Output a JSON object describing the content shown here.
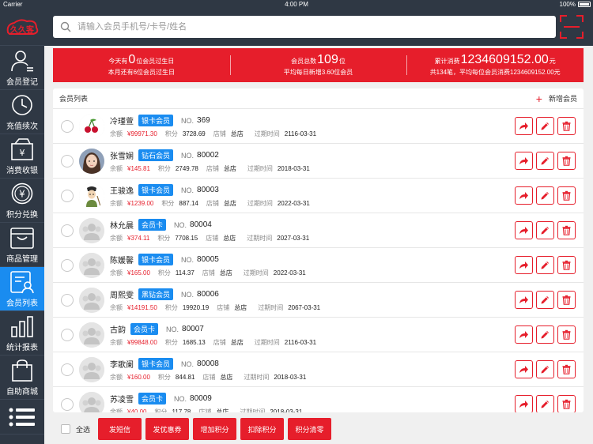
{
  "status": {
    "carrier": "Carrier",
    "time": "4:00 PM",
    "battery": "100%"
  },
  "app": {
    "logo": "久久客"
  },
  "sidebar": {
    "items": [
      {
        "label": "会员登记",
        "icon": "member-register-icon"
      },
      {
        "label": "充值续次",
        "icon": "clock-icon"
      },
      {
        "label": "消费收银",
        "icon": "cashier-icon"
      },
      {
        "label": "积分兑换",
        "icon": "points-exchange-icon"
      },
      {
        "label": "商品管理",
        "icon": "product-box-icon"
      },
      {
        "label": "会员列表",
        "icon": "member-list-icon",
        "active": true
      },
      {
        "label": "统计报表",
        "icon": "bar-chart-icon"
      },
      {
        "label": "自助商城",
        "icon": "shopping-bag-icon"
      }
    ],
    "menu_icon": "menu-icon"
  },
  "search": {
    "placeholder": "请输入会员手机号/卡号/姓名"
  },
  "stats": {
    "birthday": {
      "prefix": "今天有",
      "count": "0",
      "suffix": "位会员过生日",
      "sub": "本月还有6位会员过生日"
    },
    "members": {
      "prefix": "会员总数",
      "count": "109",
      "suffix": "位",
      "sub": "平均每日新增3.60位会员"
    },
    "spend": {
      "prefix": "累计消费",
      "count": "1234609152.00",
      "suffix": "元",
      "sub": "共134笔，平均每位会员消费1234609152.00元"
    }
  },
  "list": {
    "title": "会员列表",
    "add_label": "新增会员",
    "labels": {
      "no": "NO.",
      "balance": "余额",
      "points": "积分",
      "store": "店铺",
      "expiry": "过期时间"
    },
    "rows": [
      {
        "name": "冷瑾萱",
        "level": "银卡会员",
        "no": "369",
        "balance": "¥99971.30",
        "points": "3728.69",
        "store": "总店",
        "expiry": "2116-03-31",
        "avatar": "cherries"
      },
      {
        "name": "张雪娴",
        "level": "钻石会员",
        "no": "80002",
        "balance": "¥145.81",
        "points": "2749.78",
        "store": "总店",
        "expiry": "2018-03-31",
        "avatar": "girl"
      },
      {
        "name": "王骏逸",
        "level": "银卡会员",
        "no": "80003",
        "balance": "¥1239.00",
        "points": "887.14",
        "store": "总店",
        "expiry": "2022-03-31",
        "avatar": "cartoon"
      },
      {
        "name": "林允晨",
        "level": "会员卡",
        "no": "80004",
        "balance": "¥374.11",
        "points": "7708.15",
        "store": "总店",
        "expiry": "2027-03-31",
        "avatar": "default"
      },
      {
        "name": "陈媛馨",
        "level": "银卡会员",
        "no": "80005",
        "balance": "¥165.00",
        "points": "114.37",
        "store": "总店",
        "expiry": "2022-03-31",
        "avatar": "default"
      },
      {
        "name": "周熙雯",
        "level": "黑钻会员",
        "no": "80006",
        "balance": "¥14191.50",
        "points": "19920.19",
        "store": "总店",
        "expiry": "2067-03-31",
        "avatar": "default"
      },
      {
        "name": "古韵",
        "level": "会员卡",
        "no": "80007",
        "balance": "¥99848.00",
        "points": "1685.13",
        "store": "总店",
        "expiry": "2116-03-31",
        "avatar": "default"
      },
      {
        "name": "李歌阑",
        "level": "银卡会员",
        "no": "80008",
        "balance": "¥160.00",
        "points": "844.81",
        "store": "总店",
        "expiry": "2018-03-31",
        "avatar": "default"
      },
      {
        "name": "苏凌雪",
        "level": "会员卡",
        "no": "80009",
        "balance": "¥40.00",
        "points": "117.78",
        "store": "总店",
        "expiry": "2018-03-31",
        "avatar": "default"
      }
    ]
  },
  "bottom": {
    "select_all": "全选",
    "buttons": [
      "发短信",
      "发优惠券",
      "增加积分",
      "扣除积分",
      "积分清零"
    ]
  },
  "colors": {
    "accent": "#e61e2b",
    "sidebar": "#2f3844",
    "active": "#1a8cf0"
  }
}
